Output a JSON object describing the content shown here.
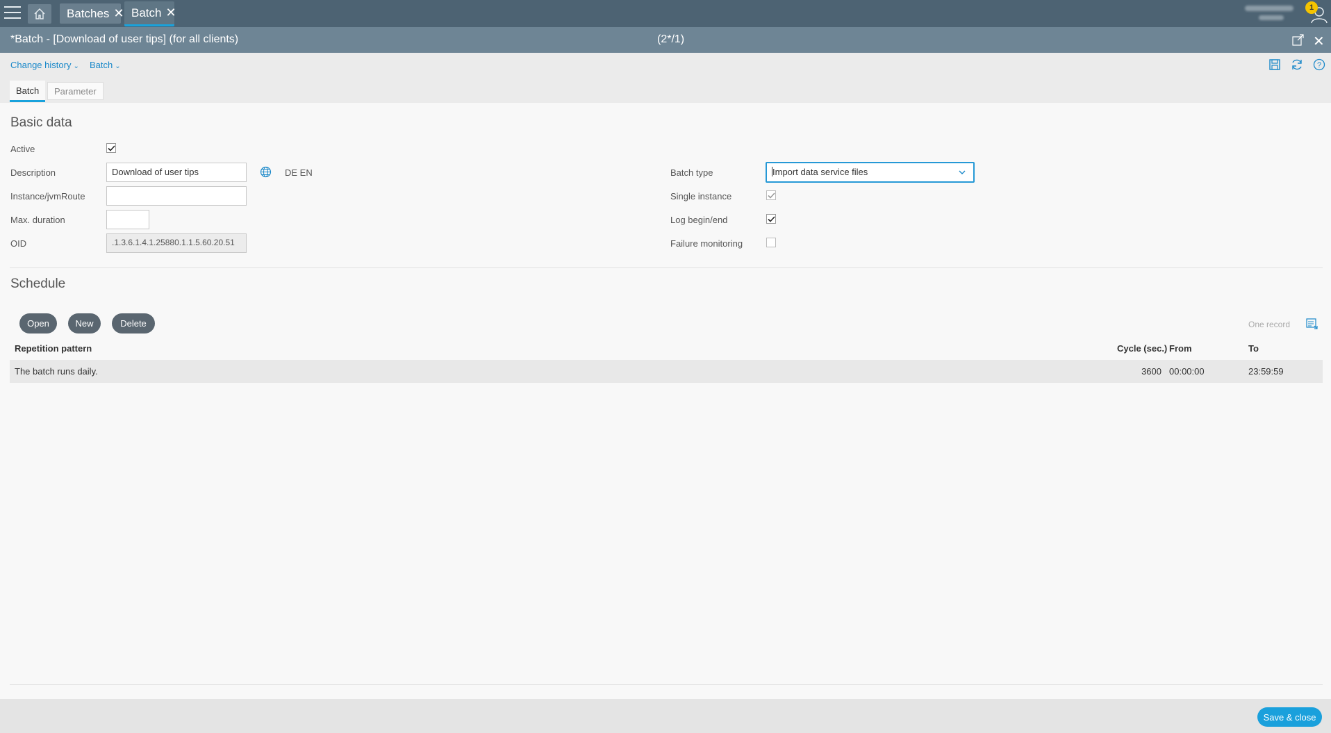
{
  "topbar": {
    "tabs": [
      {
        "label": "Batches"
      },
      {
        "label": "Batch"
      }
    ],
    "notification_count": "1"
  },
  "titlebar": {
    "title": "*Batch - [Download of user tips] (for all clients)",
    "counter": "(2*/1)"
  },
  "toolbar": {
    "change_history": "Change history",
    "batch_menu": "Batch"
  },
  "subtabs": [
    {
      "label": "Batch"
    },
    {
      "label": "Parameter"
    }
  ],
  "basic": {
    "title": "Basic data",
    "active_label": "Active",
    "description_label": "Description",
    "description_value": "Download of user tips",
    "languages": "DE EN",
    "instance_label": "Instance/jvmRoute",
    "instance_value": "",
    "maxdur_label": "Max. duration",
    "maxdur_value": "",
    "oid_label": "OID",
    "oid_value": ".1.3.6.1.4.1.25880.1.1.5.60.20.51",
    "batchtype_label": "Batch type",
    "batchtype_value": "Import data service files",
    "single_label": "Single instance",
    "log_label": "Log begin/end",
    "failure_label": "Failure monitoring"
  },
  "schedule": {
    "title": "Schedule",
    "buttons": {
      "open": "Open",
      "new": "New",
      "delete": "Delete"
    },
    "record_count": "One record",
    "columns": {
      "pattern": "Repetition pattern",
      "cycle": "Cycle (sec.)",
      "from": "From",
      "to": "To"
    },
    "rows": [
      {
        "pattern": "The batch runs daily.",
        "cycle": "3600",
        "from": "00:00:00",
        "to": "23:59:59"
      }
    ]
  },
  "footer": {
    "save_close": "Save & close"
  },
  "colors": {
    "accent": "#19a2dc",
    "topbar": "#4d6373",
    "titlebar": "#6e8595"
  }
}
